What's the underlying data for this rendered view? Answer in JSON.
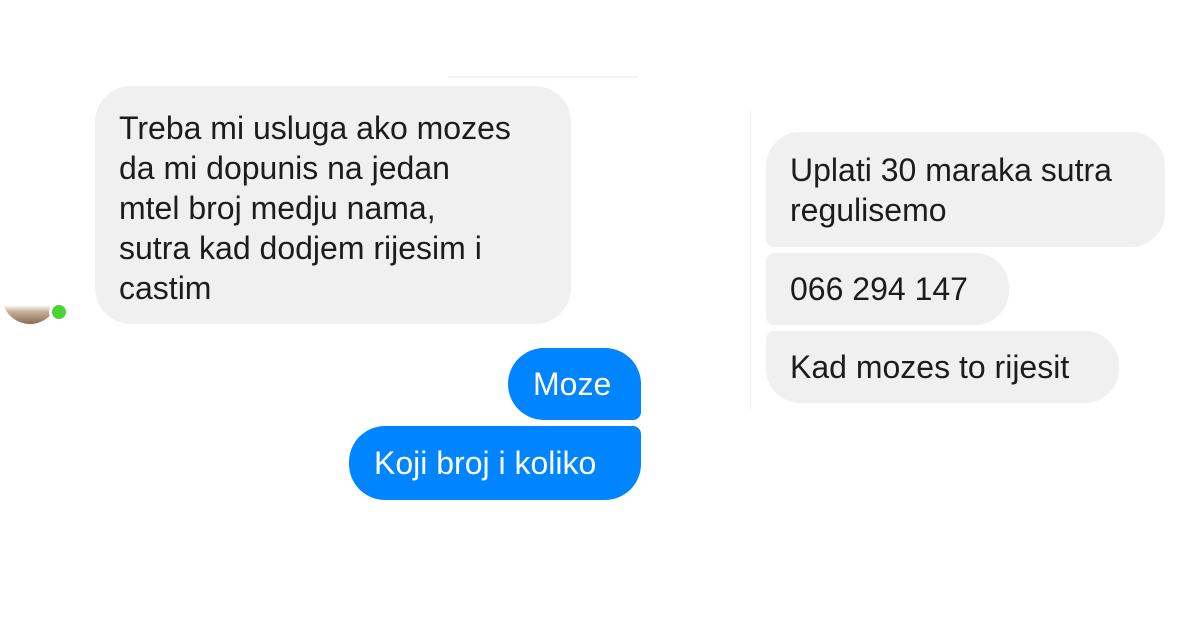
{
  "left_chat": {
    "messages": [
      {
        "direction": "incoming",
        "text": "Treba mi usluga ako mozes\nda mi dopunis na jedan\nmtel broj medju nama,\nsutra kad dodjem rijesim i\ncastim"
      },
      {
        "direction": "outgoing",
        "text": "Moze"
      },
      {
        "direction": "outgoing",
        "text": "Koji broj i koliko"
      }
    ],
    "online_status": "online"
  },
  "right_chat": {
    "messages": [
      {
        "direction": "incoming",
        "text": "Uplati 30 maraka sutra\nregulisemo"
      },
      {
        "direction": "incoming",
        "text": "066 294 147"
      },
      {
        "direction": "incoming",
        "text": "Kad mozes to rijesit"
      }
    ]
  },
  "colors": {
    "incoming_bubble": "#f1f0f0",
    "outgoing_bubble": "#0084ff",
    "online_indicator": "#4cd137"
  },
  "icons": {
    "avatar": "avatar",
    "online": "online-status-icon"
  }
}
